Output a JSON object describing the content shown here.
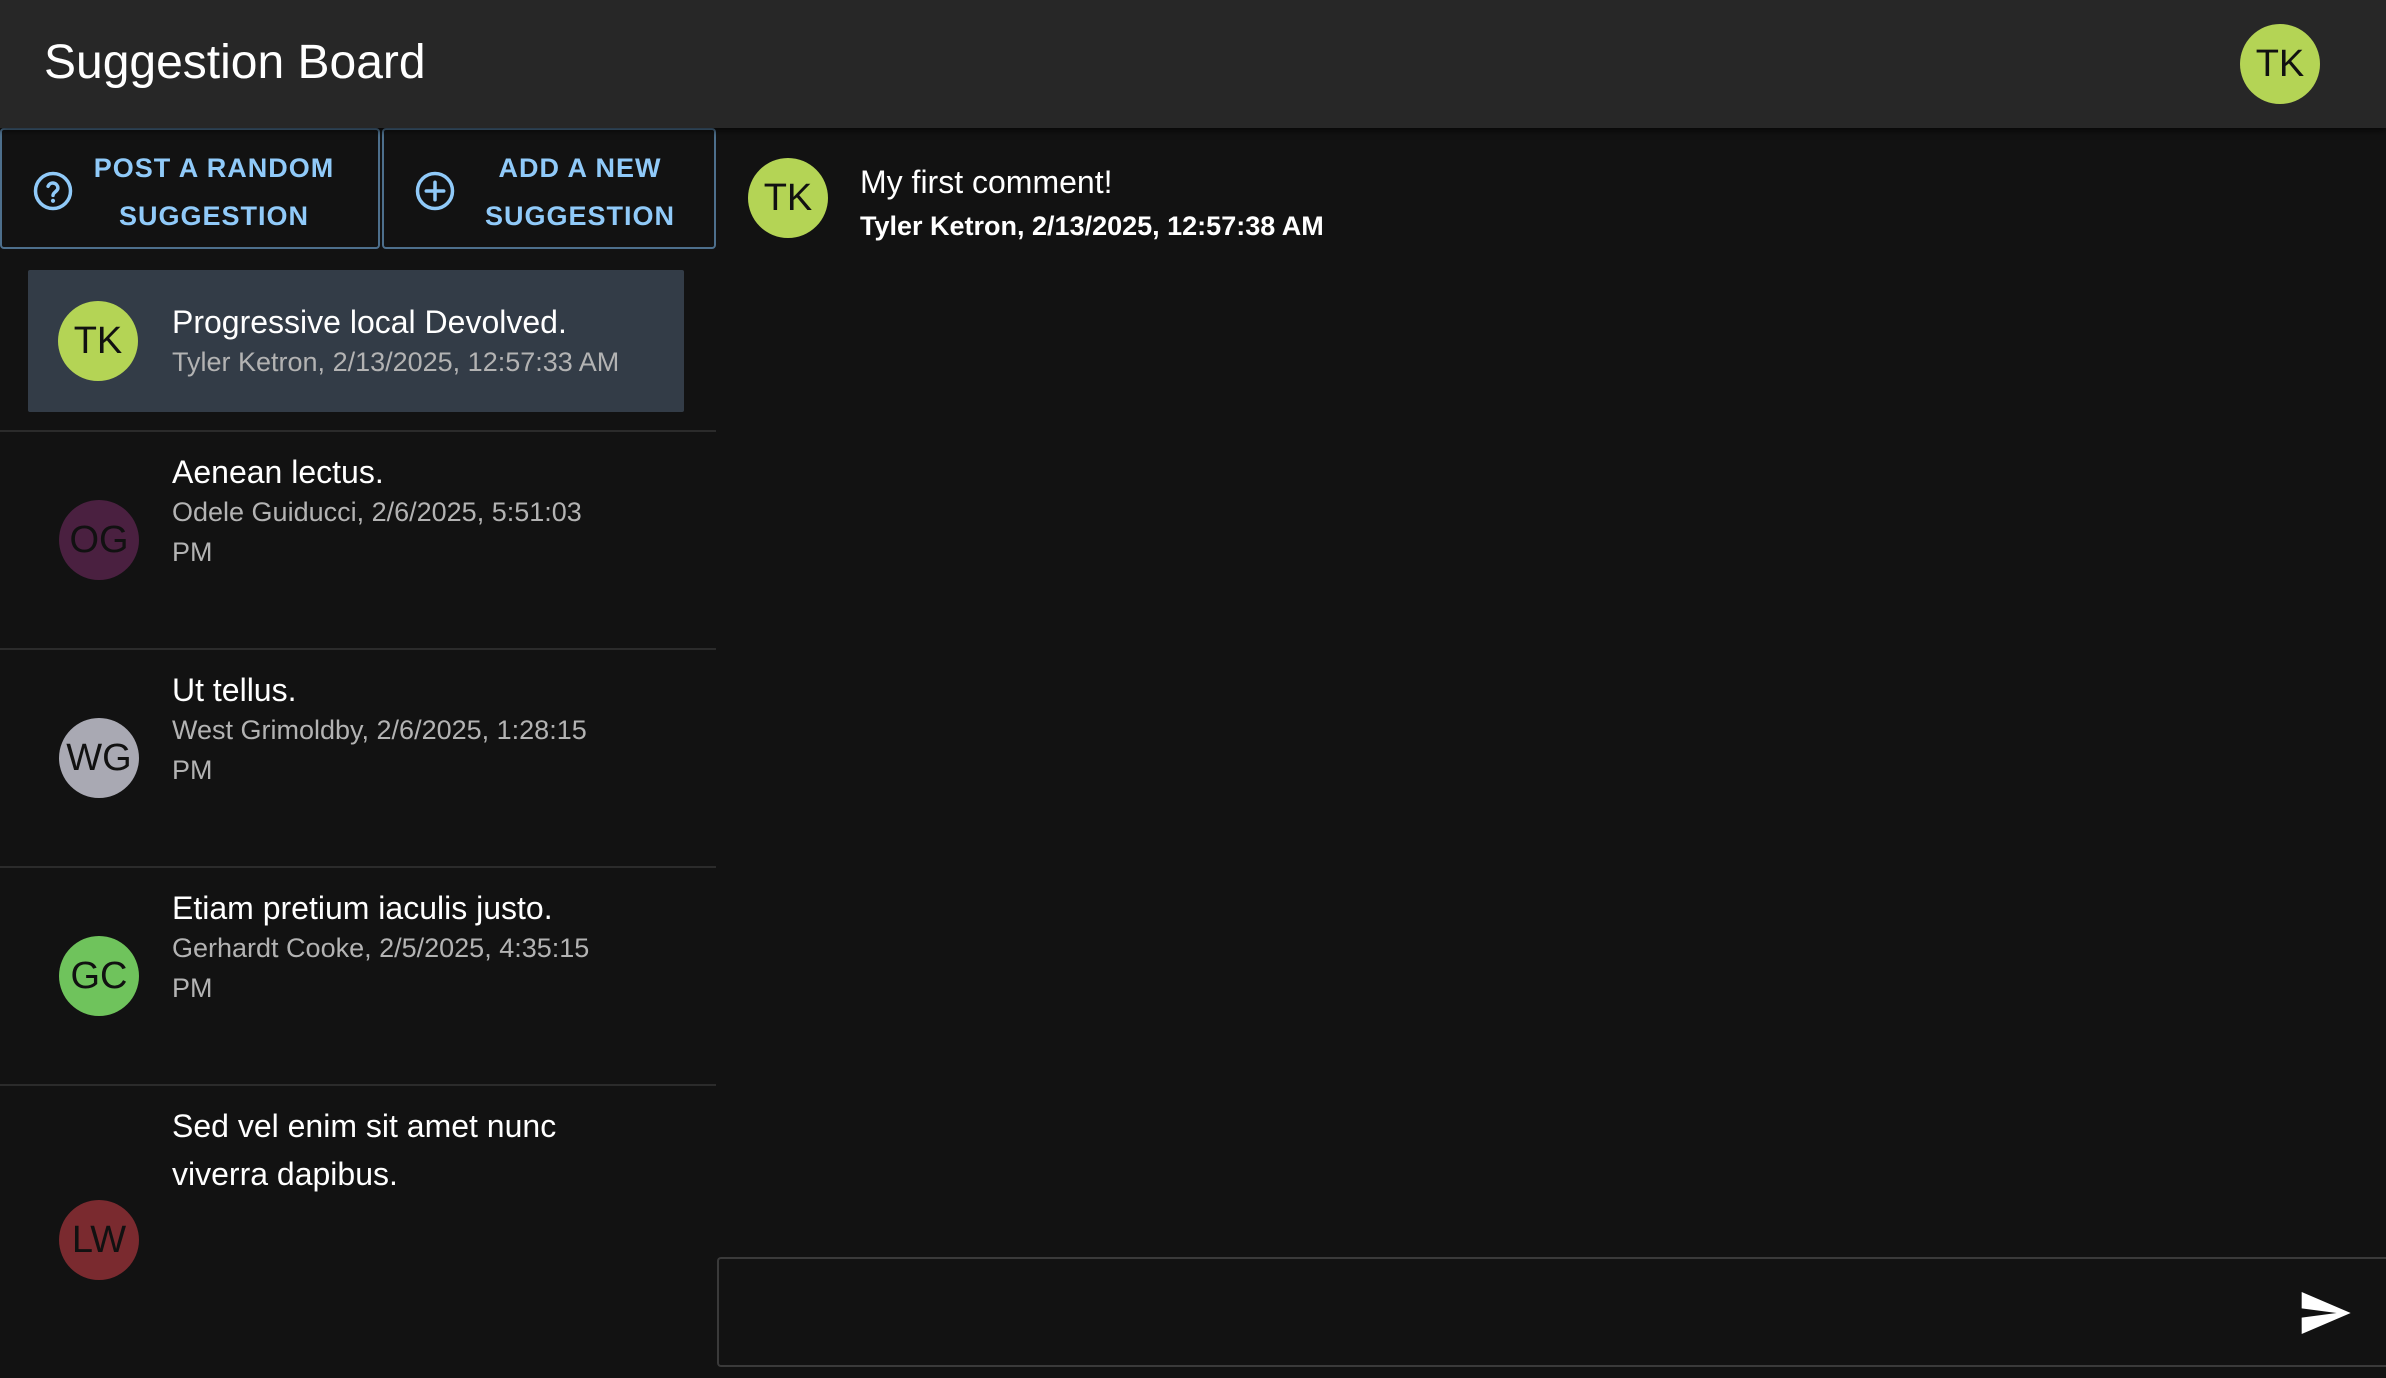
{
  "app": {
    "title": "Suggestion Board",
    "user_initials": "TK",
    "user_avatar_color": "#b4d455"
  },
  "actions": {
    "random_label_line1": "POST A RANDOM",
    "random_label_line2": "SUGGESTION",
    "random_icon": "help-circle-icon",
    "new_label_line1": "ADD A NEW",
    "new_label_line2": "SUGGESTION",
    "new_icon": "add-circle-icon"
  },
  "suggestions": [
    {
      "initials": "TK",
      "avatar_color": "#b4d455",
      "title": "Progressive local Devolved.",
      "meta_line1": "Tyler Ketron, 2/13/2025, 12:57:33 AM",
      "meta_line2": "",
      "selected": true
    },
    {
      "initials": "OG",
      "avatar_color": "#4a2040",
      "title": "Aenean lectus.",
      "meta_line1": "Odele Guiducci, 2/6/2025, 5:51:03",
      "meta_line2": "PM",
      "selected": false
    },
    {
      "initials": "WG",
      "avatar_color": "#a9a9b3",
      "title": "Ut tellus.",
      "meta_line1": "West Grimoldby, 2/6/2025, 1:28:15",
      "meta_line2": "PM",
      "selected": false
    },
    {
      "initials": "GC",
      "avatar_color": "#6fc35c",
      "title": "Etiam pretium iaculis justo.",
      "meta_line1": "Gerhardt Cooke, 2/5/2025, 4:35:15",
      "meta_line2": "PM",
      "selected": false
    },
    {
      "initials": "LW",
      "avatar_color": "#7a2a2f",
      "title_line1": "Sed vel enim sit amet nunc",
      "title_line2": "viverra dapibus.",
      "selected": false
    }
  ],
  "comments": [
    {
      "initials": "TK",
      "avatar_color": "#b4d455",
      "text": "My first comment!",
      "meta": "Tyler Ketron, 2/13/2025, 12:57:38 AM"
    }
  ],
  "composer": {
    "value": "",
    "placeholder": "",
    "send_icon": "send-icon"
  }
}
